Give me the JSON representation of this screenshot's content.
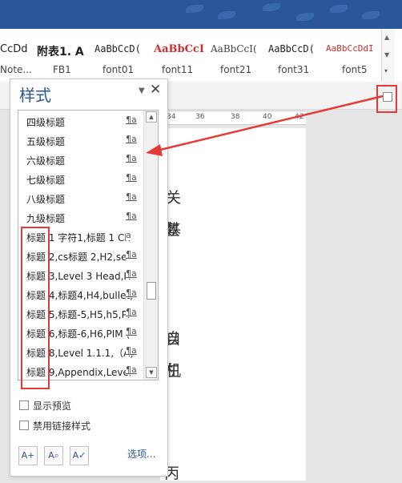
{
  "gallery": {
    "items": [
      {
        "sample": "CcDd",
        "name": "Note..."
      },
      {
        "sample": "附表1. A",
        "name": "FB1"
      },
      {
        "sample": "AaBbCcD(",
        "name": "font01"
      },
      {
        "sample": "AaBbCcI",
        "name": "font11"
      },
      {
        "sample": "AaBbCcI(",
        "name": "font21"
      },
      {
        "sample": "AaBbCcD(",
        "name": "font31"
      },
      {
        "sample": "AaBbCcDdI",
        "name": "font5"
      }
    ]
  },
  "ruler": {
    "ticks": [
      "24",
      "34",
      "36",
      "38",
      "40",
      "42"
    ]
  },
  "doc": {
    "chars": [
      "忄",
      "关",
      "数",
      "基",
      "以",
      "自",
      "在",
      "机",
      "丙"
    ]
  },
  "pane": {
    "title": "样式",
    "styles": [
      {
        "label": "四级标题",
        "mark": "¶a"
      },
      {
        "label": "五级标题",
        "mark": "¶a"
      },
      {
        "label": "六级标题",
        "mark": "¶a"
      },
      {
        "label": "七级标题",
        "mark": "¶a"
      },
      {
        "label": "八级标题",
        "mark": "¶a"
      },
      {
        "label": "九级标题",
        "mark": "¶a"
      },
      {
        "label": "标题 1 字符1,标题 1 Ch",
        "mark": "a"
      },
      {
        "label": "标题 2,cs标题 2,H2,se",
        "mark": "¶a"
      },
      {
        "label": "标题 3,Level 3 Head,H",
        "mark": "¶a"
      },
      {
        "label": "标题 4,标题4,H4,bullet,",
        "mark": "¶a"
      },
      {
        "label": "标题 5,标题-5,H5,h5,Pl",
        "mark": "¶a"
      },
      {
        "label": "标题 6,标题-6,H6,PIM (",
        "mark": "¶a"
      },
      {
        "label": "标题 8,Level 1.1.1,（A)",
        "mark": "¶a"
      },
      {
        "label": "标题 9,Appendix,Level",
        "mark": "¶a"
      }
    ],
    "show_preview": "显示预览",
    "disable_linked": "禁用链接样式",
    "options": "选项..."
  },
  "colors": {
    "accent": "#2b579a",
    "annotation": "#e53935"
  }
}
